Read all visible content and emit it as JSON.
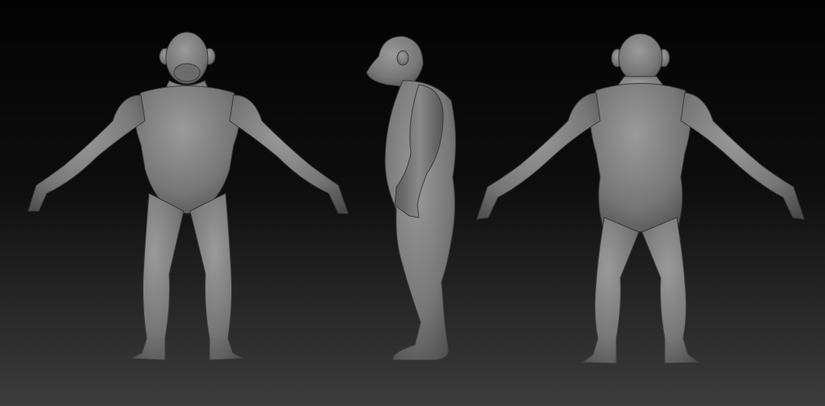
{
  "scene": {
    "views": [
      "front",
      "side",
      "back"
    ],
    "colors": {
      "background_top": "#030303",
      "background_bottom": "#3c3c3c",
      "clay": "#7a7a7a",
      "clay_shadow": "#4a4a4a",
      "clay_highlight": "#9a9a9a"
    }
  }
}
